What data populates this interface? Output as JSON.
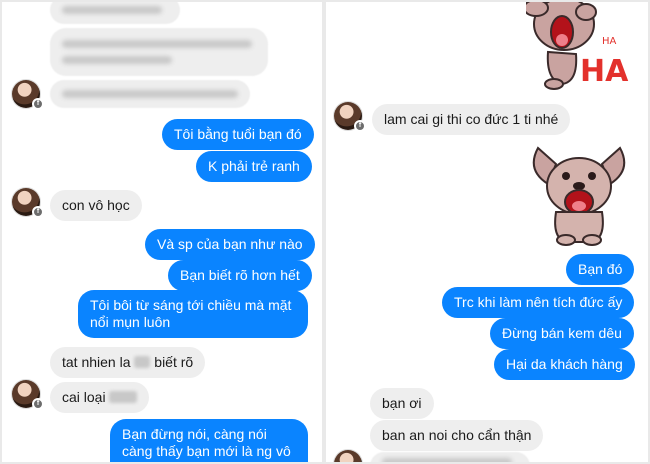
{
  "left": {
    "messages": {
      "m1": "Tôi bằng tuổi bạn đó",
      "m2": "K phải trẻ ranh",
      "m3": "con vô học",
      "m4": "Và sp của bạn như nào",
      "m5": "Bạn biết rõ hơn hết",
      "m6": "Tôi bôi từ sáng tới chiều mà mặt nổi mụn luôn",
      "m7a": "tat nhien la",
      "m7b": "biết rõ",
      "m8": "cai loại",
      "m9": "Bạn đừng nói, càng nói càng thấy bạn mới là ng vô học đó"
    }
  },
  "right": {
    "sticker_text_small": "HA",
    "sticker_text_big": "HA",
    "messages": {
      "r1": "lam cai gi thi co đức 1 ti nhé",
      "r2": "Bạn đó",
      "r3": "Trc khi làm nên tích đức ấy",
      "r4": "Đừng bán kem dêu",
      "r5": "Hại da khách hàng",
      "r6": "bạn ơi",
      "r7": "ban an noi cho cẩn thận"
    }
  },
  "colors": {
    "outgoing": "#0a84ff",
    "incoming": "#eeeeee",
    "sticker_red": "#e3312c"
  },
  "icons": [
    "avatar",
    "messenger-badge-icon",
    "laughing-dog-sticker",
    "dog-sticker"
  ]
}
